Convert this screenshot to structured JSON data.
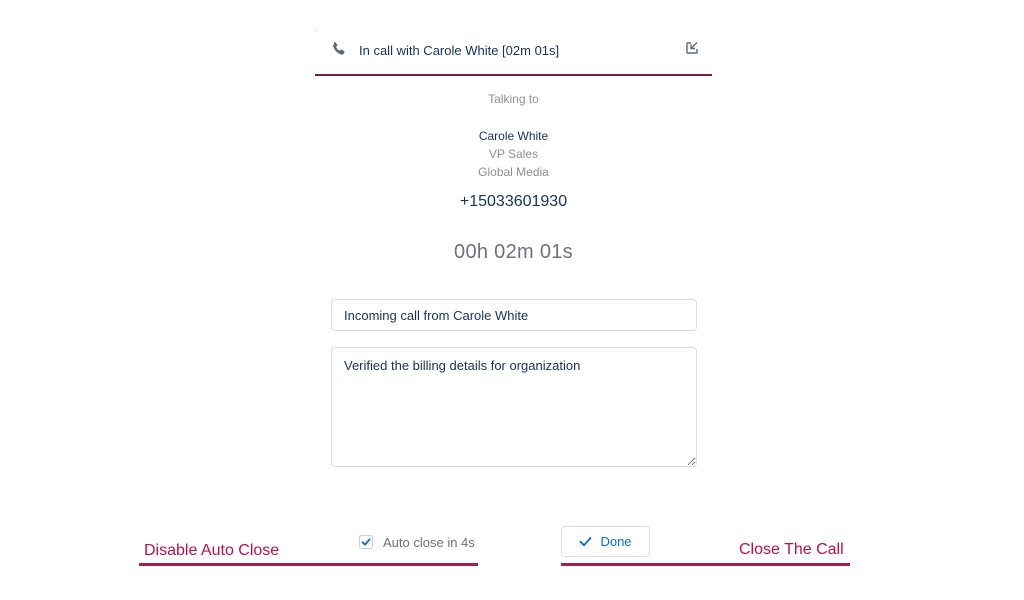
{
  "header": {
    "title": "In call with Carole White [02m 01s]"
  },
  "contact": {
    "talking_to_label": "Talking to",
    "name": "Carole White",
    "title": "VP Sales",
    "company": "Global Media",
    "phone": "+15033601930",
    "timer": "00h 02m 01s"
  },
  "form": {
    "subject_value": "Incoming call from Carole White",
    "notes_value": "Verified the billing details for organization"
  },
  "footer": {
    "auto_close_label": "Auto close in 4s",
    "auto_close_checked": true,
    "done_label": "Done"
  },
  "annotations": {
    "left": "Disable Auto Close",
    "right": "Close The Call"
  },
  "colors": {
    "accent": "#7d1a46",
    "annotation": "#b5124a",
    "link_blue": "#0070d2",
    "text_dark": "#16325c",
    "text_muted": "#8a8f97"
  },
  "icons": {
    "phone": "phone-icon",
    "popout": "popout-icon",
    "check": "check-icon"
  }
}
